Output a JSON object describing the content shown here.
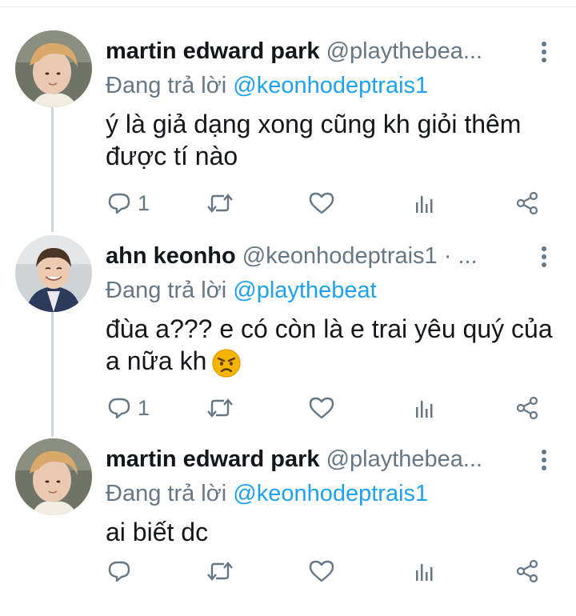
{
  "replying_prefix": "Đang trả lời",
  "tweets": [
    {
      "name": "martin edward park",
      "handle": "@playthebea...",
      "reply_to": "@keonhodeptrais1",
      "text": "ý là giả dạng xong cũng kh giỏi thêm được tí nào",
      "emoji": "",
      "reply_count": "1",
      "retweet_count": "",
      "like_count": ""
    },
    {
      "name": "ahn keonho",
      "handle": "@keonhodeptrais1 · ...",
      "reply_to": "@playthebeat",
      "text": "đùa a??? e có còn là e trai yêu quý của a nữa kh",
      "emoji": "angry-face",
      "reply_count": "1",
      "retweet_count": "",
      "like_count": ""
    },
    {
      "name": "martin edward park",
      "handle": "@playthebea...",
      "reply_to": "@keonhodeptrais1",
      "text": "ai biết dc",
      "emoji": "",
      "reply_count": "",
      "retweet_count": "",
      "like_count": ""
    }
  ],
  "icons": {
    "reply": "speech-bubble-icon",
    "retweet": "retweet-icon",
    "like": "heart-icon",
    "analytics": "bar-chart-icon",
    "share": "share-icon",
    "more": "vertical-dots-icon"
  },
  "colors": {
    "mention": "#1da1f2",
    "secondary_text": "#657786",
    "primary_text": "#14171a",
    "thread_line": "#ccd6dd"
  }
}
